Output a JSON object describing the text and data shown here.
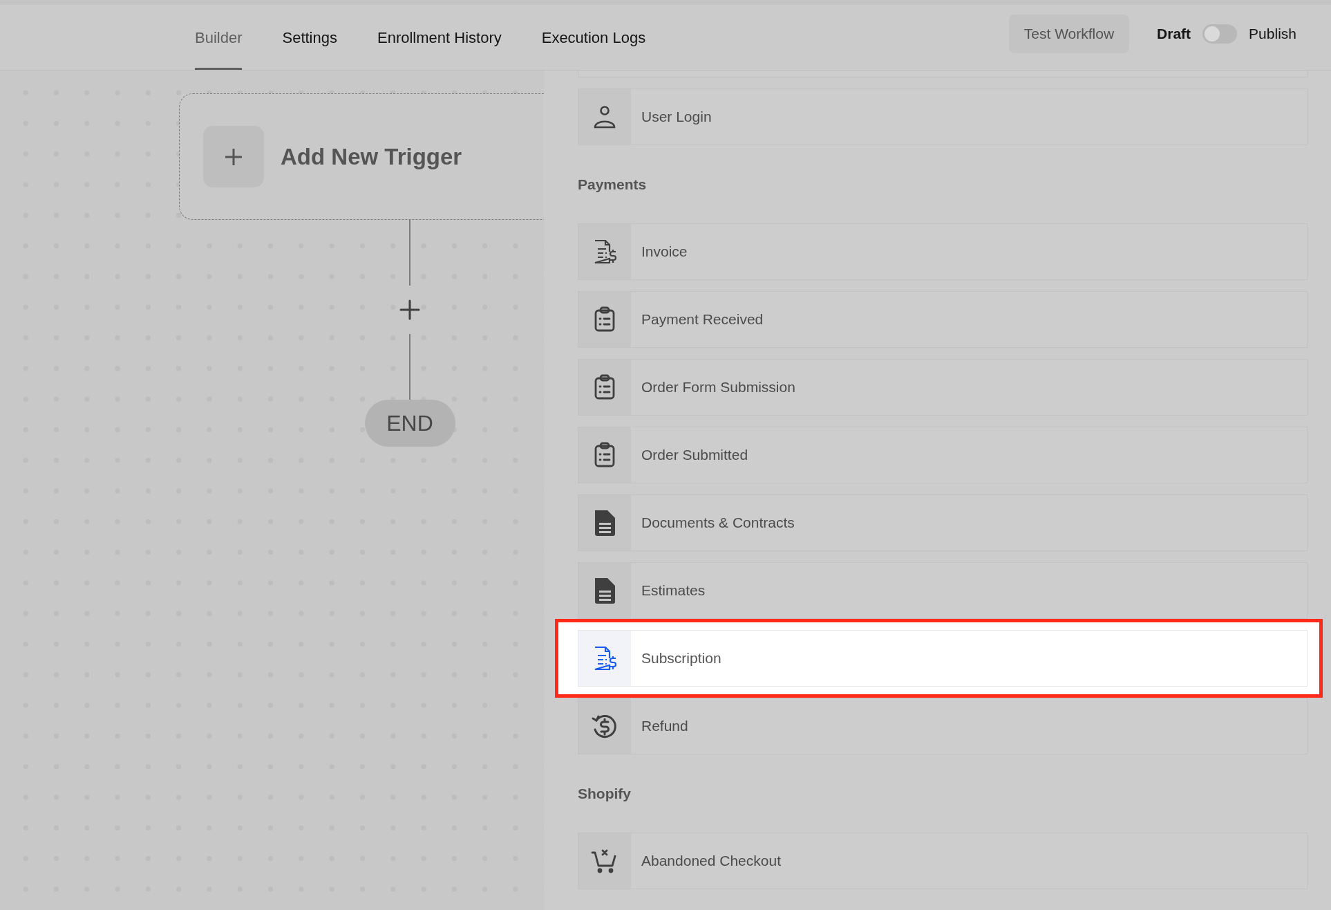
{
  "tabs": [
    {
      "label": "Builder",
      "selected": true
    },
    {
      "label": "Settings",
      "selected": false
    },
    {
      "label": "Enrollment History",
      "selected": false
    },
    {
      "label": "Execution Logs",
      "selected": false
    }
  ],
  "test_button": "Test Workflow",
  "publish_toggle": {
    "off_label": "Draft",
    "on_label": "Publish",
    "on": false
  },
  "canvas": {
    "trigger_label": "Add New Trigger",
    "end_label": "END"
  },
  "panel": {
    "items": [
      {
        "label": "User Login",
        "kind": "user",
        "highlighted": false
      }
    ],
    "groups": [
      {
        "title": "Payments",
        "items": [
          {
            "label": "Invoice",
            "kind": "invoice",
            "highlighted": false
          },
          {
            "label": "Payment Received",
            "kind": "clipboard",
            "highlighted": false
          },
          {
            "label": "Order Form Submission",
            "kind": "clipboard",
            "highlighted": false
          },
          {
            "label": "Order Submitted",
            "kind": "clipboard",
            "highlighted": false
          },
          {
            "label": "Documents & Contracts",
            "kind": "document",
            "highlighted": false
          },
          {
            "label": "Estimates",
            "kind": "document",
            "highlighted": false
          },
          {
            "label": "Subscription",
            "kind": "invoice",
            "highlighted": true
          },
          {
            "label": "Refund",
            "kind": "refund",
            "highlighted": false
          }
        ]
      },
      {
        "title": "Shopify",
        "items": [
          {
            "label": "Abandoned Checkout",
            "kind": "cart-remove",
            "highlighted": false
          }
        ]
      }
    ]
  }
}
